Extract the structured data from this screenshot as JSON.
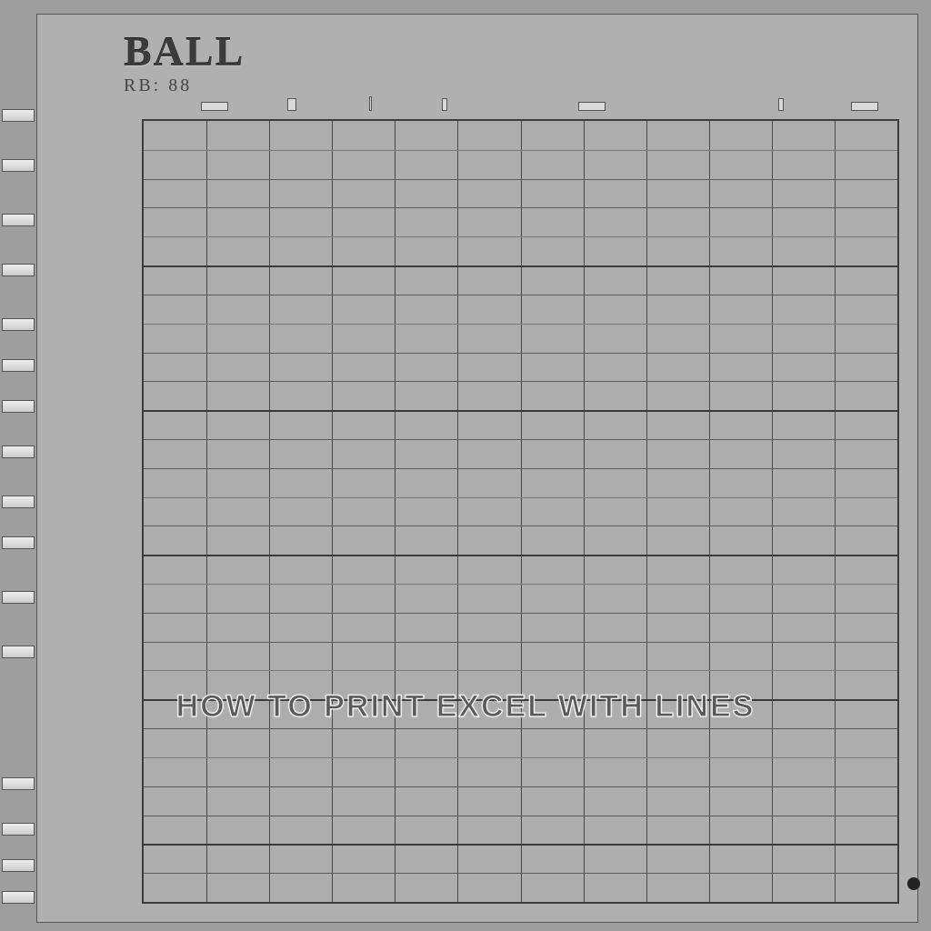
{
  "brand": {
    "main": "BALL",
    "sub": "RB: 88"
  },
  "caption": "How to Print Excel with Lines",
  "grid": {
    "columns": 12,
    "rows": 27
  },
  "colors": {
    "bg": "#9e9e9e",
    "sheet": "#b0b0b0",
    "line": "#4a4a4a"
  }
}
